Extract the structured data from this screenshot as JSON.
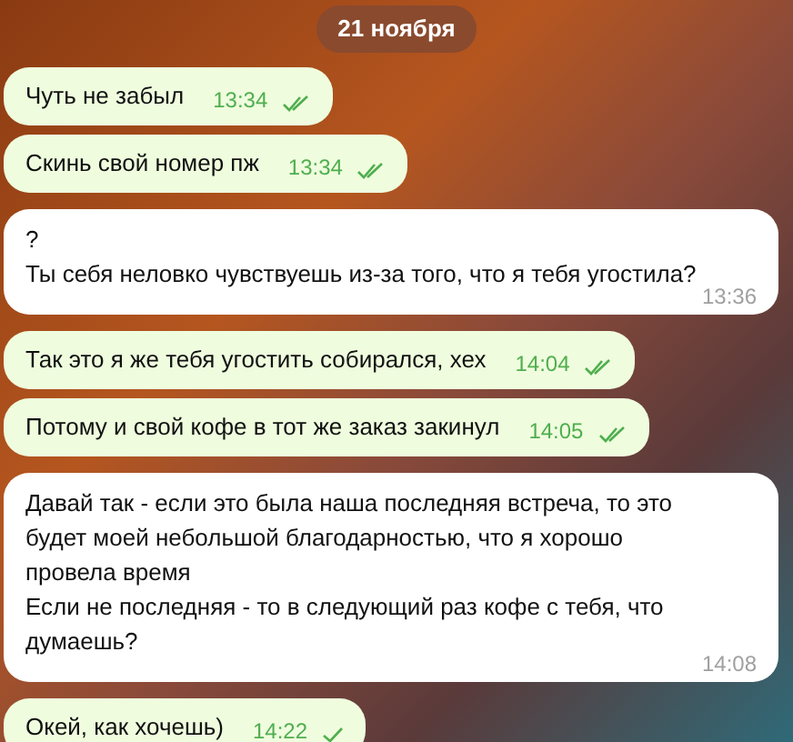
{
  "date_badge": "21 ноября",
  "messages": [
    {
      "kind": "out",
      "text": "Чуть не забыл",
      "time": "13:34",
      "read": true
    },
    {
      "kind": "out",
      "text": "Скинь свой номер пж",
      "time": "13:34",
      "read": true
    },
    {
      "kind": "in",
      "text": "?\nТы себя неловко чувствуешь из-за того, что я тебя угостила?",
      "time": "13:36"
    },
    {
      "kind": "out",
      "text": "Так это я же тебя угостить собирался, хех",
      "time": "14:04",
      "read": true
    },
    {
      "kind": "out",
      "text": "Потому и свой кофе в тот же заказ закинул",
      "time": "14:05",
      "read": true
    },
    {
      "kind": "in",
      "text": "Давай так - если это была наша последняя встреча, то это будет моей небольшой благодарностью, что я хорошо провела время\nЕсли не последняя - то в  следующий раз кофе с тебя, что думаешь?",
      "time": "14:08"
    },
    {
      "kind": "out",
      "text": "Окей, как хочешь)",
      "time": "14:22",
      "read": false
    }
  ]
}
